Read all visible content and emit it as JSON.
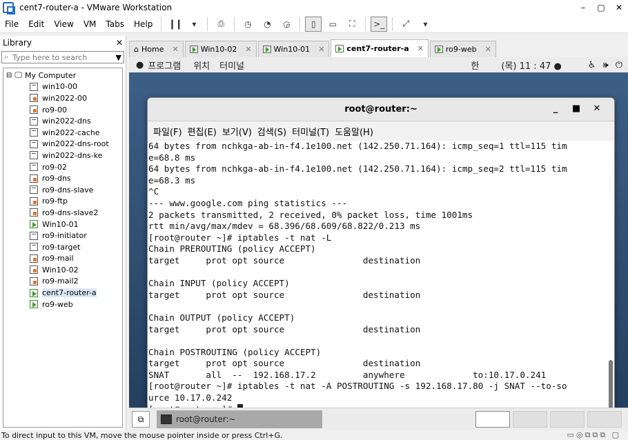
{
  "window": {
    "title": "cent7-router-a - VMware Workstation",
    "minimize": "–",
    "restore": "▢",
    "close": "✕"
  },
  "menu": [
    "File",
    "Edit",
    "View",
    "VM",
    "Tabs",
    "Help"
  ],
  "library": {
    "title": "Library",
    "close": "✕",
    "search_placeholder": "Type here to search",
    "root": "My Computer",
    "items": [
      {
        "label": "win10-00",
        "state": "plain"
      },
      {
        "label": "win2022-00",
        "state": "off"
      },
      {
        "label": "ro9-00",
        "state": "off"
      },
      {
        "label": "win2022-dns",
        "state": "plain"
      },
      {
        "label": "win2022-cache",
        "state": "plain"
      },
      {
        "label": "win2022-dns-root",
        "state": "plain"
      },
      {
        "label": "win2022-dns-ke",
        "state": "plain"
      },
      {
        "label": "ro9-02",
        "state": "plain"
      },
      {
        "label": "ro9-dns",
        "state": "off"
      },
      {
        "label": "ro9-dns-slave",
        "state": "plain"
      },
      {
        "label": "ro9-ftp",
        "state": "off"
      },
      {
        "label": "ro9-dns-slave2",
        "state": "off"
      },
      {
        "label": "Win10-01",
        "state": "on"
      },
      {
        "label": "ro9-initiator",
        "state": "plain"
      },
      {
        "label": "ro9-target",
        "state": "plain"
      },
      {
        "label": "ro9-mail",
        "state": "off"
      },
      {
        "label": "Win10-02",
        "state": "off"
      },
      {
        "label": "ro9-mail2",
        "state": "off"
      },
      {
        "label": "cent7-router-a",
        "state": "on"
      },
      {
        "label": "ro9-web",
        "state": "on"
      }
    ]
  },
  "tabs": [
    {
      "label": "Home",
      "active": false
    },
    {
      "label": "Win10-02",
      "active": false
    },
    {
      "label": "Win10-01",
      "active": false
    },
    {
      "label": "cent7-router-a",
      "active": true
    },
    {
      "label": "ro9-web",
      "active": false
    }
  ],
  "gnome": {
    "apps": "프로그램",
    "places": "위치",
    "terminal": "터미널",
    "lang": "한",
    "clock": "(목) 11 : 47 ●"
  },
  "terminal": {
    "title": "root@router:~",
    "menu": [
      "파일(F)",
      "편집(E)",
      "보기(V)",
      "검색(S)",
      "터미널(T)",
      "도움말(H)"
    ],
    "lines": [
      "64 bytes from nchkga-ab-in-f4.1e100.net (142.250.71.164): icmp_seq=1 ttl=115 tim",
      "e=68.8 ms",
      "64 bytes from nchkga-ab-in-f4.1e100.net (142.250.71.164): icmp_seq=2 ttl=115 tim",
      "e=68.3 ms",
      "^C",
      "--- www.google.com ping statistics ---",
      "2 packets transmitted, 2 received, 0% packet loss, time 1001ms",
      "rtt min/avg/max/mdev = 68.396/68.609/68.822/0.213 ms",
      "[root@router ~]# iptables -t nat -L",
      "Chain PREROUTING (policy ACCEPT)",
      "target     prot opt source               destination",
      "",
      "Chain INPUT (policy ACCEPT)",
      "target     prot opt source               destination",
      "",
      "Chain OUTPUT (policy ACCEPT)",
      "target     prot opt source               destination",
      "",
      "Chain POSTROUTING (policy ACCEPT)",
      "target     prot opt source               destination",
      "SNAT       all  --  192.168.17.2         anywhere             to:10.17.0.241",
      "[root@router ~]# iptables -t nat -A POSTROUTING -s 192.168.17.80 -j SNAT --to-so",
      "urce 10.17.0.242",
      "[root@router ~]# "
    ]
  },
  "taskbar": {
    "task_label": "root@router:~"
  },
  "status": {
    "text": "To direct input to this VM, move the mouse pointer inside or press Ctrl+G."
  }
}
